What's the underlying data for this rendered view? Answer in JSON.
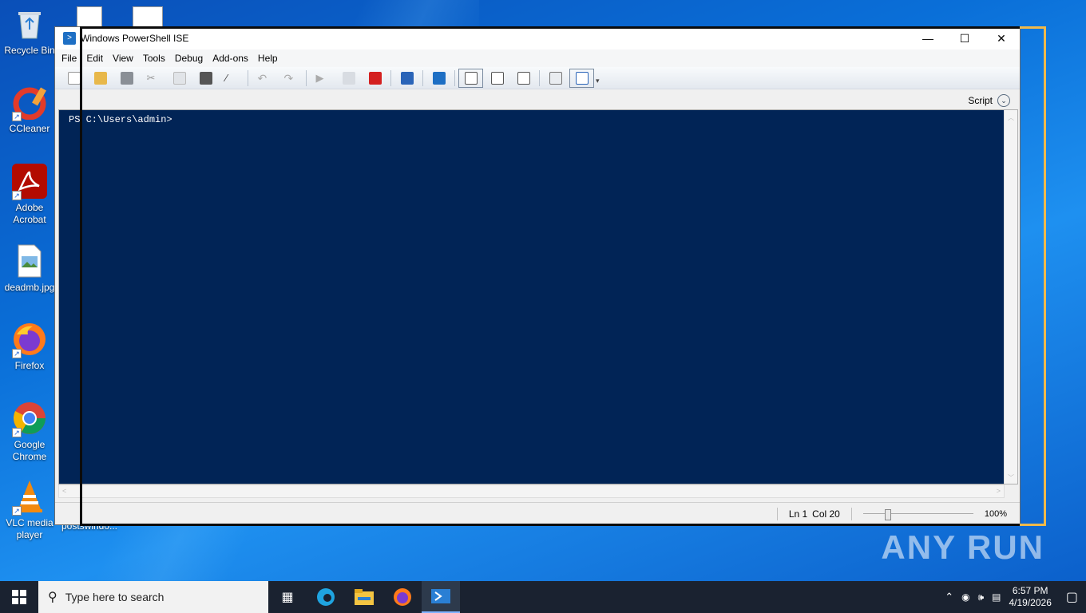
{
  "desktop": {
    "icons": [
      {
        "label": "Recycle Bin"
      },
      {
        "label": "CCleaner"
      },
      {
        "label": "Adobe Acrobat"
      },
      {
        "label": "deadmb.jpg"
      },
      {
        "label": "Firefox"
      },
      {
        "label": "Google Chrome"
      },
      {
        "label": "VLC media player"
      },
      {
        "label": "postswindo..."
      }
    ]
  },
  "window": {
    "title": "Windows PowerShell ISE",
    "menu": [
      "File",
      "Edit",
      "View",
      "Tools",
      "Debug",
      "Add-ons",
      "Help"
    ],
    "toolbar_icons": [
      "new-file-icon",
      "open-file-icon",
      "save-icon",
      "cut-icon",
      "copy-icon",
      "paste-icon",
      "clear-console-icon",
      "undo-icon",
      "redo-icon",
      "run-script-icon",
      "run-selection-icon",
      "stop-icon",
      "new-remote-tab-icon",
      "start-powershell-icon",
      "show-script-top-icon",
      "show-script-right-icon",
      "show-script-maximized-icon",
      "show-command-addon-icon",
      "show-command-window-icon"
    ],
    "script_label": "Script",
    "console_prompt": "PS C:\\Users\\admin>",
    "status": {
      "ln": "Ln 1",
      "col": "Col 20",
      "zoom": "100%",
      "zoom_level": 100
    }
  },
  "watermark": "ANY RUN",
  "taskbar": {
    "search_placeholder": "Type here to search",
    "time": "6:57 PM",
    "date": "4/19/2026"
  },
  "colors": {
    "console_bg": "#012456",
    "desktop_bg": "#0a6fd8",
    "taskbar_bg": "#1a2230",
    "highlight_frame": "#f0b94a"
  }
}
